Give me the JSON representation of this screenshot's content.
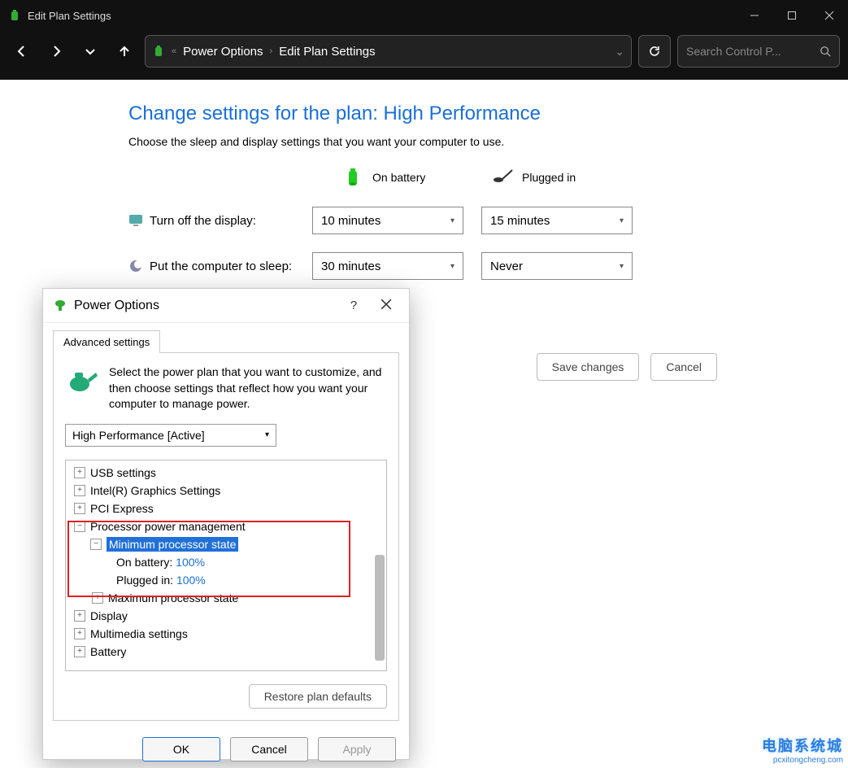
{
  "window": {
    "title": "Edit Plan Settings"
  },
  "breadcrumb": {
    "a": "Power Options",
    "b": "Edit Plan Settings"
  },
  "search": {
    "placeholder": "Search Control P..."
  },
  "page": {
    "heading": "Change settings for the plan: High Performance",
    "subtext": "Choose the sleep and display settings that you want your computer to use.",
    "col_labels": {
      "battery": "On battery",
      "plugged": "Plugged in"
    },
    "rows": {
      "display": {
        "label": "Turn off the display:",
        "battery": "10 minutes",
        "plugged": "15 minutes"
      },
      "sleep": {
        "label": "Put the computer to sleep:",
        "battery": "30 minutes",
        "plugged": "Never"
      }
    },
    "buttons": {
      "save": "Save changes",
      "cancel": "Cancel"
    }
  },
  "dialog": {
    "title": "Power Options",
    "tab": "Advanced settings",
    "intro": "Select the power plan that you want to customize, and then choose settings that reflect how you want your computer to manage power.",
    "plan_selected": "High Performance [Active]",
    "tree": {
      "usb": "USB settings",
      "intel": "Intel(R) Graphics Settings",
      "pci": "PCI Express",
      "proc": "Processor power management",
      "min": "Minimum processor state",
      "min_batt_lbl": "On battery:",
      "min_batt_val": "100%",
      "min_plug_lbl": "Plugged in:",
      "min_plug_val": "100%",
      "max": "Maximum processor state",
      "display": "Display",
      "multimedia": "Multimedia settings",
      "battery": "Battery"
    },
    "restore": "Restore plan defaults",
    "buttons": {
      "ok": "OK",
      "cancel": "Cancel",
      "apply": "Apply"
    }
  },
  "watermark": {
    "cn": "电脑系统城",
    "en": "pcxitongcheng.com"
  }
}
